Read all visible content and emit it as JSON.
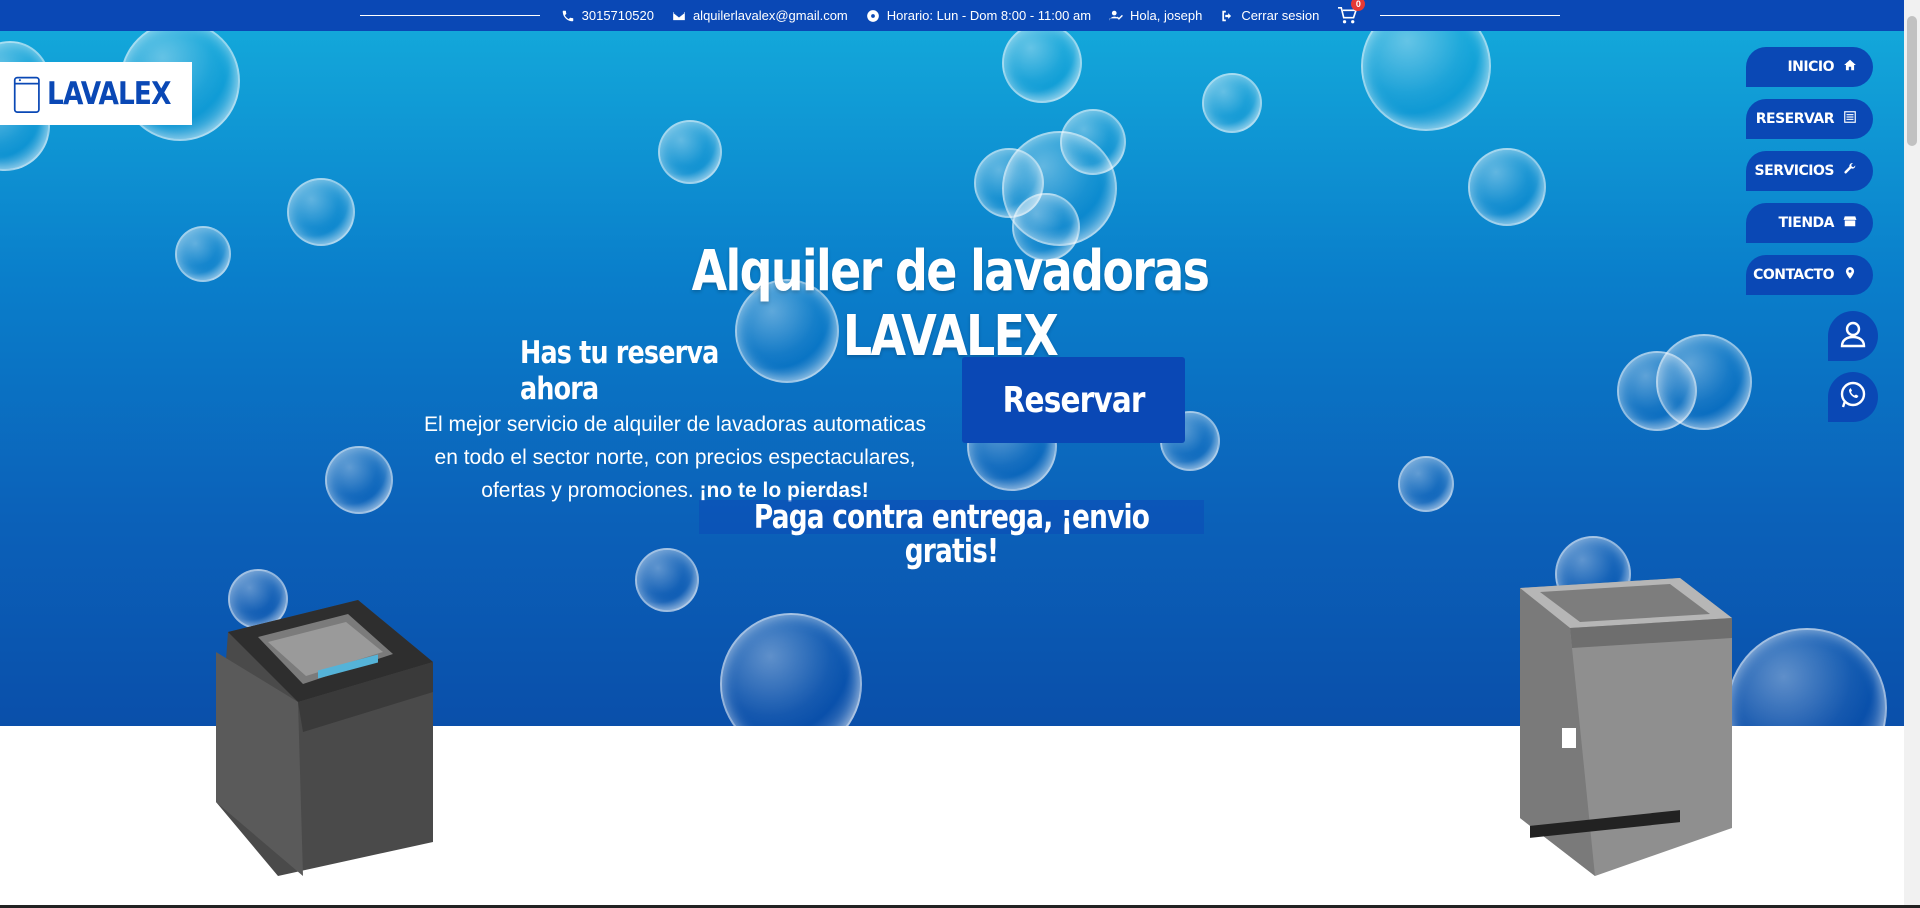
{
  "topbar": {
    "phone": "3015710520",
    "email": "alquilerlavalex@gmail.com",
    "hours": "Horario: Lun - Dom 8:00 - 11:00 am",
    "greeting": "Hola, joseph",
    "logout": "Cerrar sesion",
    "cart_count": "0",
    "icons": [
      "phone-icon",
      "envelope-icon",
      "clock-icon",
      "user-check-icon",
      "sign-out-icon",
      "shopping-cart-icon"
    ]
  },
  "brand": {
    "logo_text": "LAVALEX"
  },
  "nav": {
    "items": [
      {
        "label": "INICIO",
        "icon": "home-icon"
      },
      {
        "label": "RESERVAR",
        "icon": "list-icon"
      },
      {
        "label": "SERVICIOS",
        "icon": "wrench-icon"
      },
      {
        "label": "TIENDA",
        "icon": "store-icon"
      },
      {
        "label": "CONTACTO",
        "icon": "map-marker-icon"
      }
    ]
  },
  "floating": {
    "user_icon": "user-icon",
    "whatsapp_icon": "whatsapp-icon"
  },
  "hero": {
    "title": "Alquiler de lavadoras LAVALEX",
    "subtitle": "Has tu reserva ahora",
    "description_line1": "El mejor servicio de alquiler de lavadoras automaticas",
    "description_line2": "en todo el sector norte, con precios espectaculares,",
    "description_line3": "ofertas y promociones.",
    "description_bold": "¡no te lo pierdas!",
    "reserve_button": "Reservar",
    "payment_banner": "Paga contra entrega, ¡envio gratis!"
  },
  "colors": {
    "brand_blue": "#0a48b5",
    "hero_top": "#13a7da",
    "hero_bottom": "#0a4faa",
    "white": "#ffffff"
  }
}
